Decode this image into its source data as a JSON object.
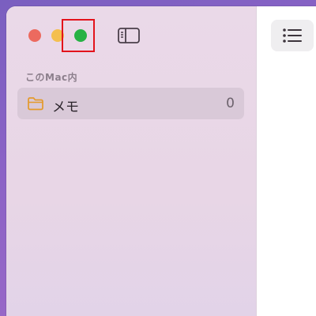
{
  "sidebar": {
    "section_header": "このMac内",
    "folders": [
      {
        "label": "メモ",
        "count": "0",
        "icon": "folder-icon"
      }
    ]
  },
  "window_controls": {
    "close": "close-button",
    "minimize": "minimize-button",
    "zoom": "zoom-button"
  },
  "toolbar": {
    "sidebar_toggle_icon": "sidebar-toggle-icon",
    "list_view_icon": "list-view-icon"
  },
  "colors": {
    "close": "#ec6a5f",
    "minimize": "#f4bf4f",
    "zoom": "#27b245",
    "highlight": "#e3131c",
    "folder_accent": "#e49a2b"
  }
}
